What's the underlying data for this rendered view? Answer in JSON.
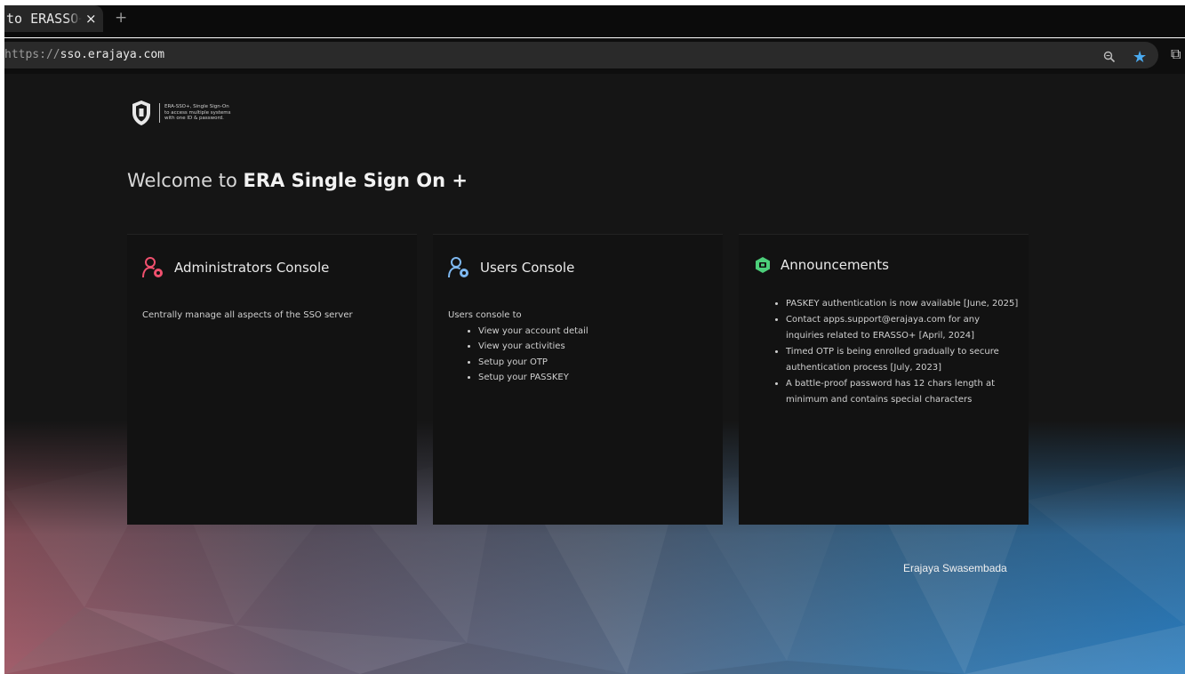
{
  "browser": {
    "tab_title": "to ERASSO+",
    "tab_close": "×",
    "new_tab": "+",
    "url_scheme": "https://",
    "url_host": "sso.erajaya.com"
  },
  "brand": {
    "tagline_1": "ERA-SSO+, Single Sign-On",
    "tagline_2": "to access multiple systems",
    "tagline_3": "with one ID & password."
  },
  "welcome": {
    "prefix": "Welcome to ",
    "name": "ERA Single Sign On +"
  },
  "cards": {
    "admin": {
      "title": "Administrators Console",
      "description": "Centrally manage all aspects of the SSO server"
    },
    "users": {
      "title": "Users Console",
      "intro": "Users console to",
      "items": [
        "View your account detail",
        "View your activities",
        "Setup your OTP",
        "Setup your PASSKEY"
      ]
    },
    "announcements": {
      "title": "Announcements",
      "items": [
        "PASKEY authentication is now available [June, 2025]",
        "Contact apps.support@erajaya.com for any inquiries related to ERASSO+ [April, 2024]",
        "Timed OTP is being enrolled gradually to secure authentication process [July, 2023]",
        "A battle-proof password has 12 chars length at minimum and contains special characters"
      ]
    }
  },
  "footer": {
    "company": "Erajaya Swasembada"
  },
  "colors": {
    "admin_icon": "#f0506e",
    "users_icon": "#7eb8f0",
    "announce_icon": "#4ccf7a",
    "star": "#4aaaf0"
  }
}
